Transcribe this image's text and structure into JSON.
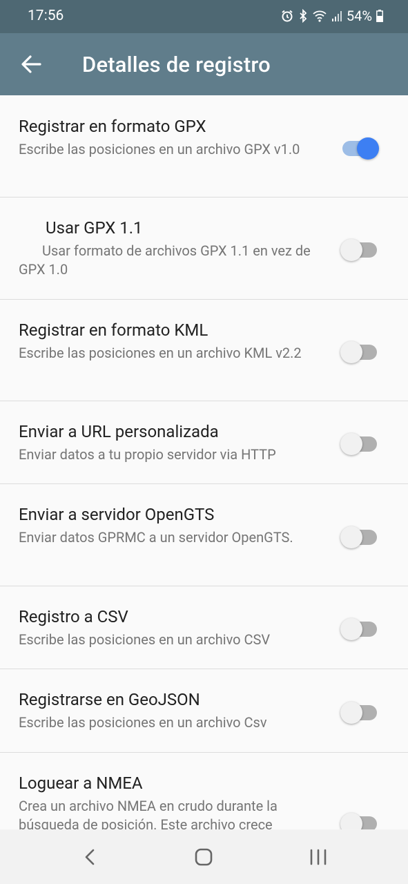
{
  "status": {
    "time": "17:56",
    "battery": "54%"
  },
  "app_bar": {
    "title": "Detalles de registro"
  },
  "settings": [
    {
      "title": "Registrar en formato GPX",
      "subtitle": "Escribe las posiciones en un archivo GPX v1.0",
      "enabled": true
    },
    {
      "title": "Usar GPX 1.1",
      "subtitle": "Usar formato de archivos GPX 1.1 en vez de GPX 1.0",
      "enabled": false
    },
    {
      "title": "Registrar en formato KML",
      "subtitle": "Escribe las posiciones en un archivo KML v2.2",
      "enabled": false
    },
    {
      "title": "Enviar a URL personalizada",
      "subtitle": "Enviar datos a tu propio servidor via HTTP",
      "enabled": false
    },
    {
      "title": "Enviar a servidor OpenGTS",
      "subtitle": "Enviar datos GPRMC a un servidor OpenGTS.",
      "enabled": false
    },
    {
      "title": "Registro a CSV",
      "subtitle": "Escribe las posiciones en un archivo CSV",
      "enabled": false
    },
    {
      "title": "Registrarse en GeoJSON",
      "subtitle": "Escribe las posiciones en un archivo Csv",
      "enabled": false
    },
    {
      "title": "Loguear a NMEA",
      "subtitle": "Crea un archivo NMEA en crudo durante la búsqueda de posición. Este archivo crece",
      "enabled": false
    }
  ],
  "colors": {
    "app_bar": "#607d8b",
    "status_bar": "#4e6873",
    "toggle_on": "#3d7ff3"
  }
}
